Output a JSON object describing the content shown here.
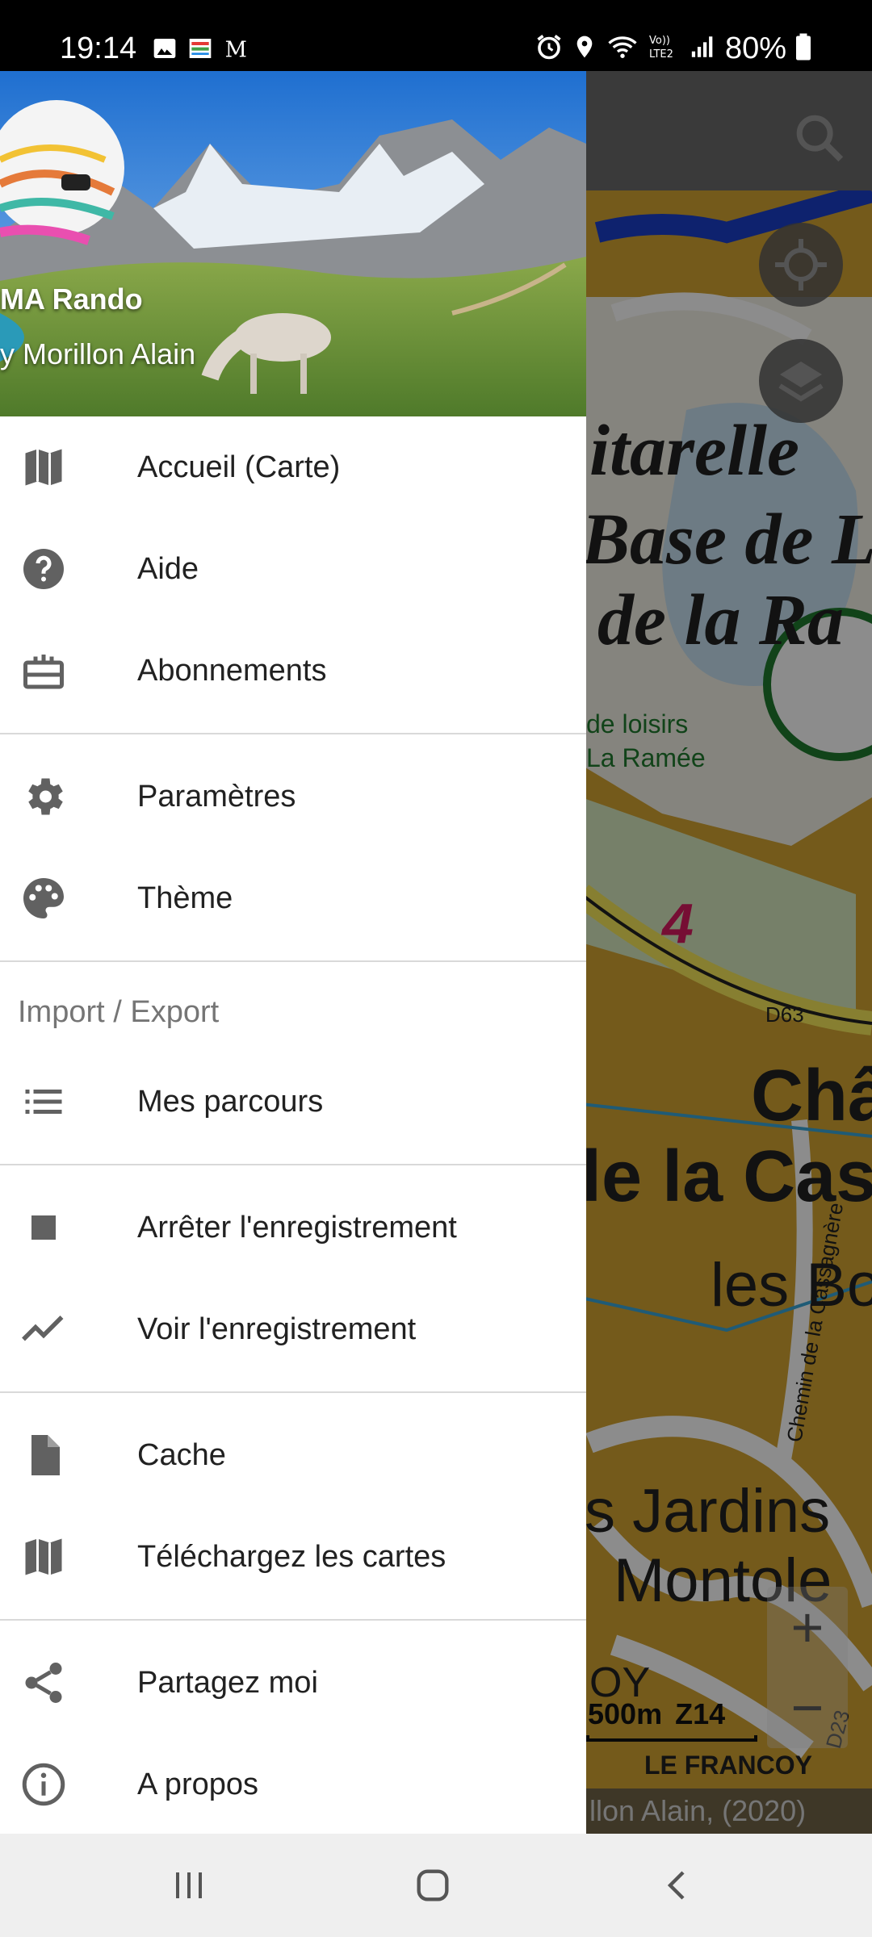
{
  "status_bar": {
    "time": "19:14",
    "battery": "80%",
    "network": "Vo)) LTE2"
  },
  "map": {
    "labels": {
      "base_de": "Base de L",
      "de_la_ra": "de la Ra",
      "itarelle": "itarelle",
      "loisirs": "de loisirs",
      "la_ramee": "La Ramée",
      "number_4": "4",
      "d63": "D63",
      "cha": "Châ",
      "le_la_cass": "le la Cass",
      "les_bo": "les Bo",
      "chemin": "Chemin de la Cassagnère",
      "jardins": "s Jardins",
      "montole": "Montole",
      "oy": "OY",
      "d23": "D23",
      "le_francoy": "LE FRANCOY"
    },
    "scale_distance": "500m",
    "zoom_level": "Z14",
    "attribution": "llon Alain, (2020)",
    "zoom_in": "+",
    "zoom_out": "−"
  },
  "drawer": {
    "header": {
      "title": "MA Rando",
      "subtitle": "y Morillon Alain"
    },
    "items": [
      {
        "label": "Accueil (Carte)",
        "icon": "map-icon"
      },
      {
        "label": "Aide",
        "icon": "help-icon"
      },
      {
        "label": "Abonnements",
        "icon": "subscriptions-icon"
      },
      {
        "label": "Paramètres",
        "icon": "gear-icon"
      },
      {
        "label": "Thème",
        "icon": "palette-icon"
      },
      {
        "label": "Mes parcours",
        "icon": "list-icon"
      },
      {
        "label": "Arrêter l'enregistrement",
        "icon": "stop-icon"
      },
      {
        "label": "Voir l'enregistrement",
        "icon": "trending-icon"
      },
      {
        "label": "Cache",
        "icon": "file-icon"
      },
      {
        "label": "Téléchargez les cartes",
        "icon": "map-download-icon"
      },
      {
        "label": "Partagez moi",
        "icon": "share-icon"
      },
      {
        "label": "A propos",
        "icon": "info-icon"
      }
    ],
    "section_import_export": "Import / Export"
  }
}
